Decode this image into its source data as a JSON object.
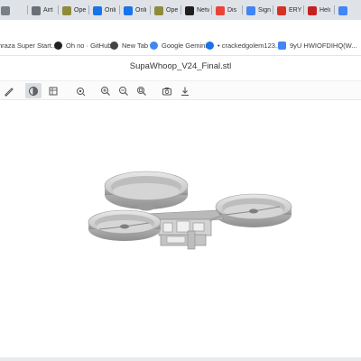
{
  "browser": {
    "tabs": [
      {
        "label": "",
        "icon": "globe-icon",
        "color": "#7a7f86"
      },
      {
        "label": "Airt",
        "icon": "globe-icon",
        "color": "#6b7078"
      },
      {
        "label": "Ope",
        "icon": "chatgpt-icon",
        "color": "#8f8b3a"
      },
      {
        "label": "Onli",
        "icon": "doc-icon",
        "color": "#1a73e8"
      },
      {
        "label": "Onli",
        "icon": "doc-icon",
        "color": "#1a73e8"
      },
      {
        "label": "Ope",
        "icon": "chatgpt-icon",
        "color": "#8f8b3a"
      },
      {
        "label": "Netv",
        "icon": "netflix-icon",
        "color": "#1f1f1f"
      },
      {
        "label": "Dis",
        "icon": "google-icon",
        "color": "#ea4335"
      },
      {
        "label": "Sign",
        "icon": "google-icon",
        "color": "#4285f4"
      },
      {
        "label": "ERY",
        "icon": "bookmark-icon",
        "color": "#d93025"
      },
      {
        "label": "Helı",
        "icon": "gmail-icon",
        "color": "#c5221f"
      },
      {
        "label": "",
        "icon": "google-icon",
        "color": "#4285f4"
      }
    ],
    "bookmarks": [
      {
        "label": "nraza Super Start...",
        "icon": "star-icon",
        "color": "#f2a93b"
      },
      {
        "label": "Oh no · GitHub",
        "icon": "github-icon",
        "color": "#222222"
      },
      {
        "label": "New Tab",
        "icon": "newtab-icon",
        "color": "#444444"
      },
      {
        "label": "Google Gemini",
        "icon": "gemini-icon",
        "color": "#4285f4"
      },
      {
        "label": "• crackedgolem123...",
        "icon": "profile-icon",
        "color": "#1a73e8"
      },
      {
        "label": "9yU HWIOFDIHQ(W...",
        "icon": "doc-icon",
        "color": "#4285f4"
      }
    ]
  },
  "app": {
    "file_title": "SupaWhoop_V24_Final.stl",
    "toolbar": [
      {
        "name": "draw-tool-icon",
        "active": false
      },
      {
        "name": "shaded-view-icon",
        "active": true
      },
      {
        "name": "wireframe-view-icon",
        "active": false
      },
      {
        "name": "measure-icon",
        "active": false
      },
      {
        "name": "zoom-in-icon",
        "active": false
      },
      {
        "name": "zoom-out-icon",
        "active": false
      },
      {
        "name": "zoom-fit-icon",
        "active": false
      },
      {
        "name": "screenshot-icon",
        "active": false
      },
      {
        "name": "download-icon",
        "active": false
      }
    ],
    "model_color": "#cfcfcf"
  }
}
